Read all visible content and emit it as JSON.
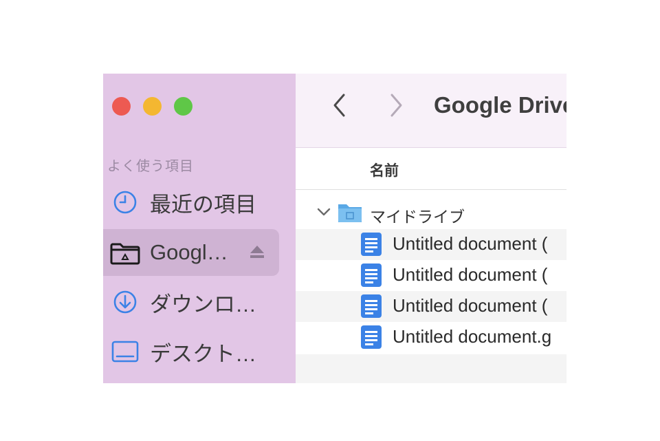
{
  "window": {
    "title": "Google Drive",
    "traffic_lights": [
      {
        "name": "close-button",
        "color": "#ed5a52"
      },
      {
        "name": "minimize-button",
        "color": "#f4b731"
      },
      {
        "name": "zoom-button",
        "color": "#5fc747"
      }
    ]
  },
  "sidebar": {
    "section_label": "よく使う項目",
    "items": [
      {
        "label": "最近の項目",
        "icon": "clock-icon",
        "selected": false
      },
      {
        "label": "Googl…",
        "icon": "drive-folder-icon",
        "selected": true,
        "eject_icon": "eject-icon"
      },
      {
        "label": "ダウンロ…",
        "icon": "download-icon",
        "selected": false
      },
      {
        "label": "デスクト…",
        "icon": "desktop-icon",
        "selected": false
      }
    ]
  },
  "toolbar": {
    "back_icon": "chevron-left-icon",
    "forward_icon": "chevron-right-icon"
  },
  "list": {
    "column_name": "名前",
    "folder": {
      "label": "マイドライブ",
      "expanded": true,
      "icon": "folder-icon"
    },
    "files": [
      {
        "label": "Untitled document (",
        "icon": "google-doc-icon"
      },
      {
        "label": "Untitled document (",
        "icon": "google-doc-icon"
      },
      {
        "label": "Untitled document (",
        "icon": "google-doc-icon"
      },
      {
        "label": "Untitled document.g",
        "icon": "google-doc-icon"
      }
    ]
  },
  "colors": {
    "sidebar_bg": "#e2c6e6",
    "selected_bg": "#cfb3d3",
    "accent_blue": "#3b82e6"
  }
}
